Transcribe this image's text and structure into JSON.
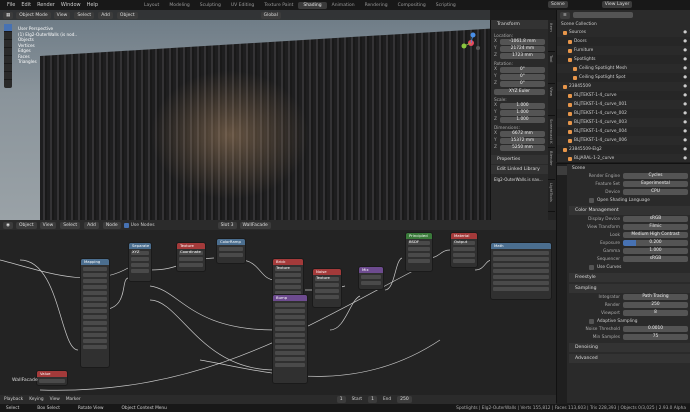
{
  "menu": [
    "File",
    "Edit",
    "Render",
    "Window",
    "Help"
  ],
  "workspaces": [
    {
      "label": "Layout",
      "on": false
    },
    {
      "label": "Modeling",
      "on": false
    },
    {
      "label": "Sculpting",
      "on": false
    },
    {
      "label": "UV Editing",
      "on": false
    },
    {
      "label": "Texture Paint",
      "on": false
    },
    {
      "label": "Shading",
      "on": true
    },
    {
      "label": "Animation",
      "on": false
    },
    {
      "label": "Rendering",
      "on": false
    },
    {
      "label": "Compositing",
      "on": false
    },
    {
      "label": "Scripting",
      "on": false
    }
  ],
  "scene_name": "Scene",
  "view_layer": "View Layer",
  "viewport": {
    "mode": "Object Mode",
    "menus": [
      "View",
      "Select",
      "Add",
      "Object"
    ],
    "orientation": "Global",
    "overlay_lines": [
      "User Perspective",
      "(1) Elg2-OuterWalls (is nod..",
      "Objects",
      "Vertices",
      "Edges",
      "Faces",
      "Triangles"
    ]
  },
  "npanel": {
    "title": "Transform",
    "loc_label": "Location:",
    "loc": [
      [
        "X",
        "-1061.8 mm"
      ],
      [
        "Y",
        "21724 mm"
      ],
      [
        "Z",
        "1723 mm"
      ]
    ],
    "rot_label": "Rotation:",
    "rot": [
      [
        "X",
        "0°"
      ],
      [
        "Y",
        "0°"
      ],
      [
        "Z",
        "0°"
      ]
    ],
    "rot_mode": "XYZ Euler",
    "scale_label": "Scale:",
    "scale": [
      [
        "X",
        "1.000"
      ],
      [
        "Y",
        "1.000"
      ],
      [
        "Z",
        "1.000"
      ]
    ],
    "dim_label": "Dimensions:",
    "dim": [
      [
        "X",
        "6672 mm"
      ],
      [
        "Y",
        "15372 mm"
      ],
      [
        "Z",
        "5250 mm"
      ]
    ],
    "properties": "Properties",
    "edit_lib": "Edit Linked Library",
    "obj": "Elg2-OuterWalls.is nav...",
    "tabs": [
      "Item",
      "Tool",
      "View",
      "Screencast K",
      "Blender",
      "LightTools"
    ]
  },
  "node_editor": {
    "editor": "Object",
    "menus": [
      "View",
      "Select",
      "Add",
      "Node"
    ],
    "use_nodes": "Use Nodes",
    "slot": "Slot 3",
    "material": "WallFacade",
    "frame_label": "WallFacade"
  },
  "nodes": [
    {
      "title": "Separate XYZ",
      "color": "#4b6e8f"
    },
    {
      "title": "Mapping",
      "color": "#4b6e8f"
    },
    {
      "title": "Texture Coordinate",
      "color": "#a33a3a"
    },
    {
      "title": "Brick Texture",
      "color": "#a33a3a"
    },
    {
      "title": "Noise Texture",
      "color": "#a33a3a"
    },
    {
      "title": "ColorRamp",
      "color": "#4b6e8f"
    },
    {
      "title": "Mix",
      "color": "#6d4b8f"
    },
    {
      "title": "Bump",
      "color": "#6d4b8f"
    },
    {
      "title": "Principled BSDF",
      "color": "#3a7a3a"
    },
    {
      "title": "Material Output",
      "color": "#a33a3a"
    },
    {
      "title": "Math",
      "color": "#4b6e8f"
    },
    {
      "title": "Value",
      "color": "#a33a3a"
    }
  ],
  "outliner": {
    "title": "Scene Collection",
    "items": [
      {
        "name": "Sources",
        "ind": 6
      },
      {
        "name": "Doors",
        "ind": 11
      },
      {
        "name": "Furniture",
        "ind": 11
      },
      {
        "name": "Spotlights",
        "ind": 11
      },
      {
        "name": "Ceiling Spotlight Mesh",
        "ind": 16
      },
      {
        "name": "Ceiling Spotlight Spot",
        "ind": 16
      },
      {
        "name": "23845509",
        "ind": 6
      },
      {
        "name": "BLJTEKST-1-4_curve",
        "ind": 11
      },
      {
        "name": "BLJTEKST-1-4_curve_001",
        "ind": 11
      },
      {
        "name": "BLJTEKST-1-4_curve_002",
        "ind": 11
      },
      {
        "name": "BLJTEKST-1-4_curve_003",
        "ind": 11
      },
      {
        "name": "BLJTEKST-1-4_curve_004",
        "ind": 11
      },
      {
        "name": "BLJTEKST-1-4_curve_006",
        "ind": 11
      },
      {
        "name": "23845509-Elg2",
        "ind": 6
      },
      {
        "name": "BLJARAL-1-2_curve",
        "ind": 11
      },
      {
        "name": "BLJARAL-1-2_curve_001",
        "ind": 11
      },
      {
        "name": "BLJARAL-1-2_curve_002",
        "ind": 11
      },
      {
        "name": "BLJARAL-1-2_curve_003",
        "ind": 11
      },
      {
        "name": "BLJARAL-1-2_curve_004",
        "ind": 11
      },
      {
        "name": "BLJARAL-1-2_curve_005",
        "ind": 11
      }
    ]
  },
  "props": {
    "scene": "Scene",
    "engine_l": "Render Engine",
    "engine": "Cycles",
    "fs_l": "Feature Set",
    "fs": "Experimental",
    "dev_l": "Device",
    "dev": "CPU",
    "osl": "Open Shading Language",
    "cm": "Color Management",
    "dd_l": "Display Device",
    "dd": "sRGB",
    "vt_l": "View Transform",
    "vt": "Filmic",
    "look_l": "Look",
    "look": "Medium High Contrast",
    "exp_l": "Exposure",
    "exp": "0.200",
    "gam_l": "Gamma",
    "gam": "1.000",
    "seq_l": "Sequencer",
    "seq": "sRGB",
    "curves": "Use Curves",
    "freestyle": "Freestyle",
    "sampling": "Sampling",
    "int_l": "Integrator",
    "int": "Path Tracing",
    "render_l": "Render",
    "render": "250",
    "vp_l": "Viewport",
    "vp": "8",
    "adaptive": "Adaptive Sampling",
    "nt_l": "Noise Threshold",
    "nt": "0.0010",
    "ms_l": "Min Samples",
    "ms": "75",
    "denoise": "Denoising",
    "advanced": "Advanced"
  },
  "status": {
    "left": [
      "Select",
      "Box Select",
      "Rotate View",
      "Object Context Menu"
    ],
    "right": "Spotlights | Elg2-OuterWalls | Verts 155,812 | Faces 113,603 | Tris 228,393 | Objects 0/3,025 | 2.93.0 Alpha"
  },
  "timeline": {
    "items": [
      "Playback",
      "Keying",
      "View",
      "Marker"
    ],
    "frame": "1",
    "start_l": "Start",
    "start": "1",
    "end_l": "End",
    "end": "250"
  }
}
